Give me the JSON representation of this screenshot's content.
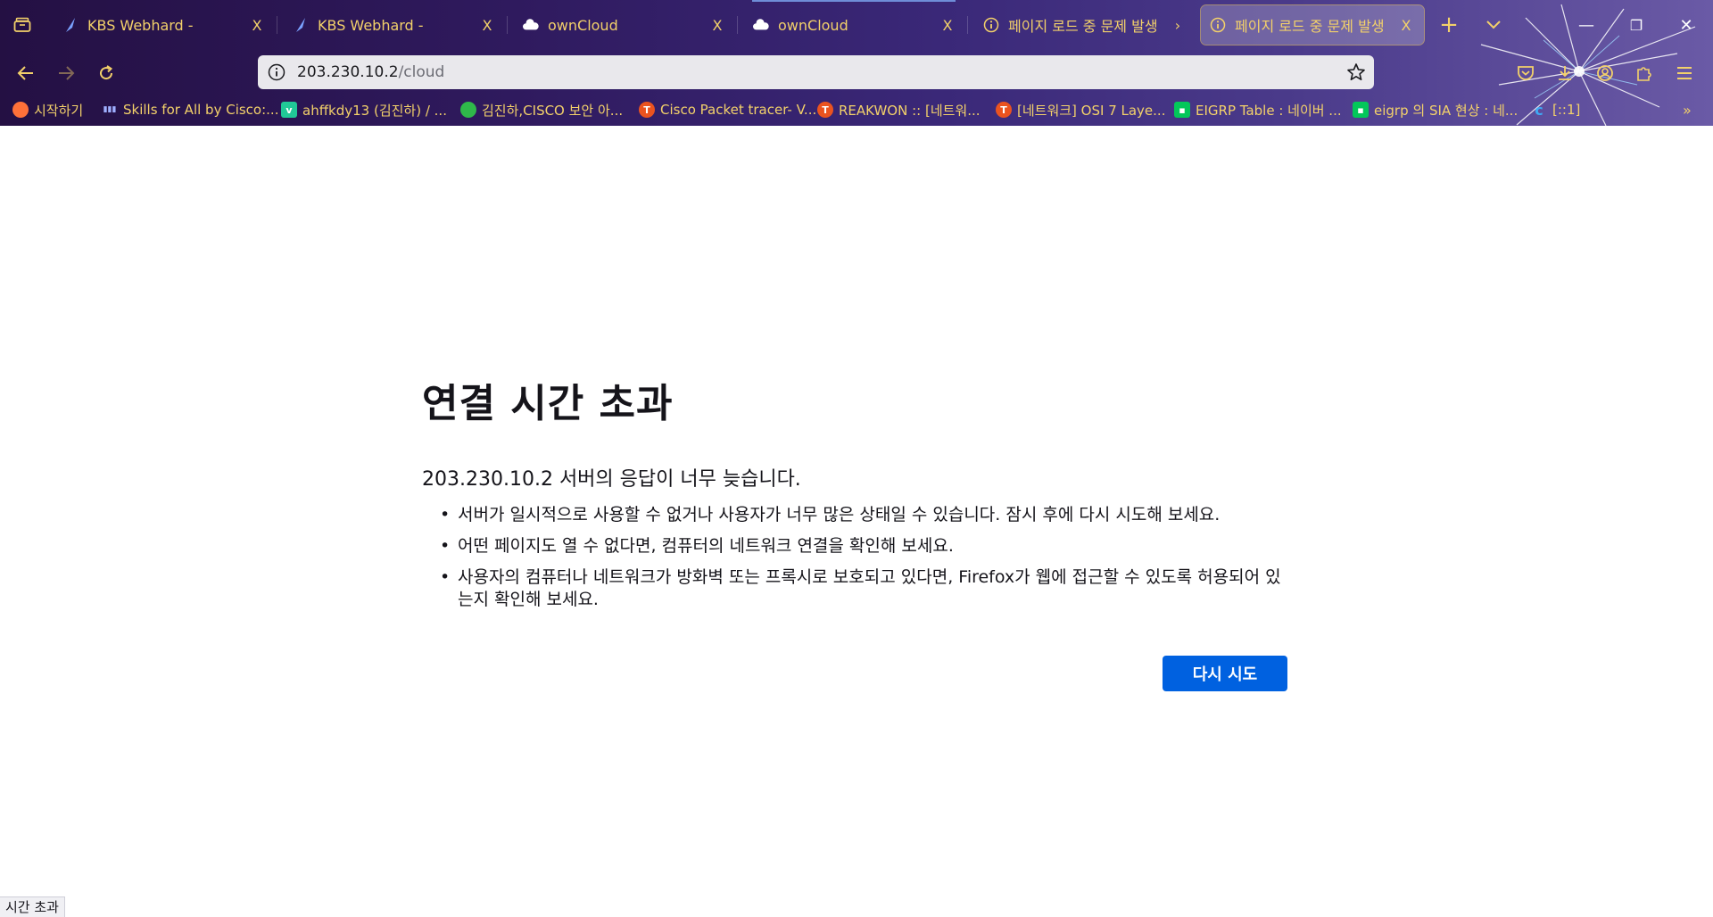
{
  "browser": {
    "tabs": [
      {
        "title": "KBS Webhard -",
        "icon": "feather-icon",
        "close": "X"
      },
      {
        "title": "KBS Webhard -",
        "icon": "feather-icon",
        "close": "X"
      },
      {
        "title": "ownCloud",
        "icon": "cloud-icon",
        "close": "X"
      },
      {
        "title": "ownCloud",
        "icon": "cloud-icon",
        "close": "X"
      },
      {
        "title": "페이지 로드 중 문제 발생",
        "icon": "info-icon",
        "close": ""
      },
      {
        "title": "페이지 로드 중 문제 발생",
        "icon": "info-icon",
        "close": "X",
        "active": true
      }
    ],
    "url": {
      "host": "203.230.10.2",
      "path": "/cloud"
    },
    "bookmarks": [
      {
        "label": "시작하기",
        "icon": "firefox-icon",
        "color": "#ff7139"
      },
      {
        "label": "Skills for All by Cisco:...",
        "icon": "cisco-icon",
        "color": "#7a8cff"
      },
      {
        "label": "ahffkdy13 (김진하) / ...",
        "icon": "velog-icon",
        "color": "#20c997"
      },
      {
        "label": "김진하,CISCO 보안 아...",
        "icon": "leaf-icon",
        "color": "#2fb84a"
      },
      {
        "label": "Cisco Packet tracer- V...",
        "icon": "tistory-icon",
        "color": "#eb531f"
      },
      {
        "label": "REAKWON :: [네트워...",
        "icon": "tistory-icon",
        "color": "#eb531f"
      },
      {
        "label": "[네트워크] OSI 7 Laye...",
        "icon": "tistory-icon",
        "color": "#eb531f"
      },
      {
        "label": "EIGRP Table : 네이버 ...",
        "icon": "naver-blog-icon",
        "color": "#03c75a"
      },
      {
        "label": "eigrp 의 SIA 현상 : 네...",
        "icon": "naver-blog-icon",
        "color": "#03c75a"
      },
      {
        "label": "[::1]",
        "icon": "globe-icon",
        "color": "#3fa9f5"
      }
    ],
    "new_tab_symbol": "+",
    "window_buttons": {
      "minimize": "—",
      "restore": "❐",
      "close": "✕"
    }
  },
  "error": {
    "title": "연결 시간 초과",
    "description": "203.230.10.2 서버의 응답이 너무 늦습니다.",
    "items": [
      "서버가 일시적으로 사용할 수 없거나 사용자가 너무 많은 상태일 수 있습니다. 잠시 후에 다시 시도해 보세요.",
      "어떤 페이지도 열 수 없다면, 컴퓨터의 네트워크 연결을 확인해 보세요.",
      "사용자의 컴퓨터나 네트워크가 방화벽 또는 프록시로 보호되고 있다면, Firefox가 웹에 접근할 수 있도록 허용되어 있는지 확인해 보세요."
    ],
    "retry_label": "다시 시도"
  },
  "status_text": "시간 초과",
  "colors": {
    "accent": "#0061e0",
    "tab_text": "#f3d16a",
    "chrome_bg": "#2f1a5e"
  }
}
